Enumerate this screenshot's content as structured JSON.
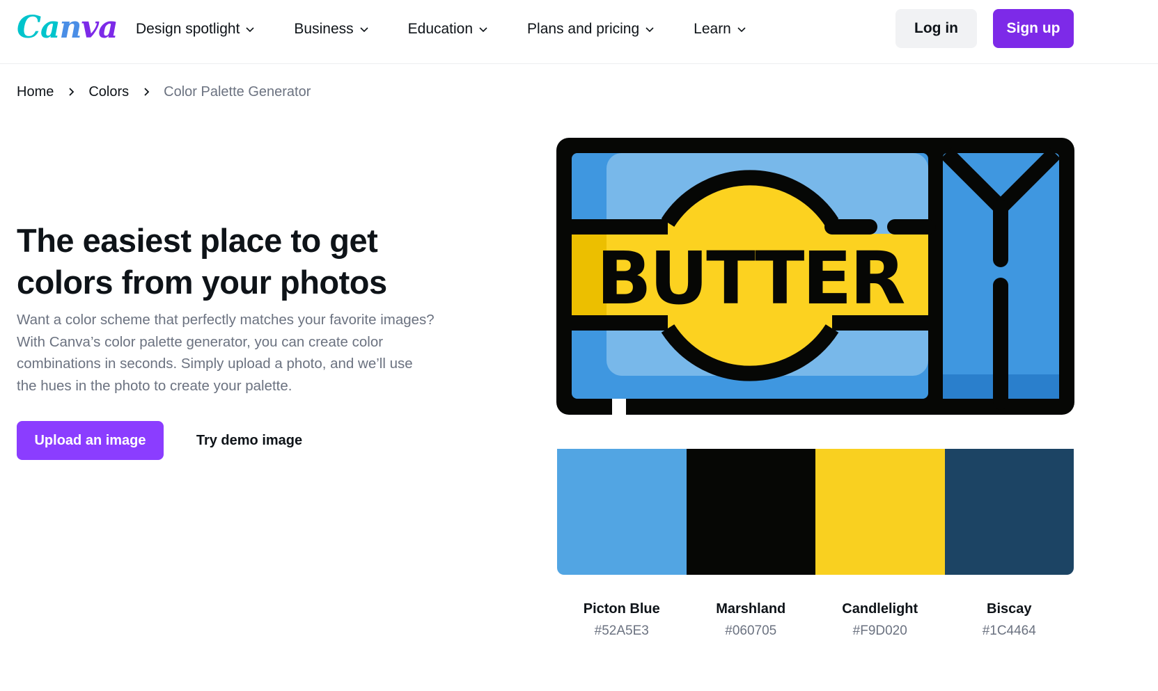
{
  "header": {
    "logo": {
      "part1": "Ca",
      "part2": "n",
      "part3": "va"
    },
    "nav": [
      {
        "label": "Design spotlight",
        "icon": "chevron-down-icon"
      },
      {
        "label": "Business",
        "icon": "chevron-down-icon"
      },
      {
        "label": "Education",
        "icon": "chevron-down-icon"
      },
      {
        "label": "Plans and pricing",
        "icon": "chevron-down-icon"
      },
      {
        "label": "Learn",
        "icon": "chevron-down-icon"
      }
    ],
    "login_label": "Log in",
    "signup_label": "Sign up"
  },
  "breadcrumb": [
    {
      "label": "Home"
    },
    {
      "label": "Colors"
    },
    {
      "label": "Color Palette Generator"
    }
  ],
  "hero": {
    "title": "The easiest place to get colors from your photos",
    "description": "Want a color scheme that perfectly matches your favorite images? With Canva’s color palette generator, you can create color combinations in seconds. Simply upload a photo, and we’ll use the hues in the photo to create your palette.",
    "upload_label": "Upload an image",
    "demo_label": "Try demo image"
  },
  "image": {
    "text": "BUTTER"
  },
  "palette": [
    {
      "name": "Picton Blue",
      "hex": "#52A5E3"
    },
    {
      "name": "Marshland",
      "hex": "#060705"
    },
    {
      "name": "Candlelight",
      "hex": "#F9D020"
    },
    {
      "name": "Biscay",
      "hex": "#1C4464"
    }
  ],
  "colors": {
    "brand_purple": "#7d2ae8",
    "upload_purple": "#8b3dff",
    "logo_teal": "#00c4cc"
  }
}
